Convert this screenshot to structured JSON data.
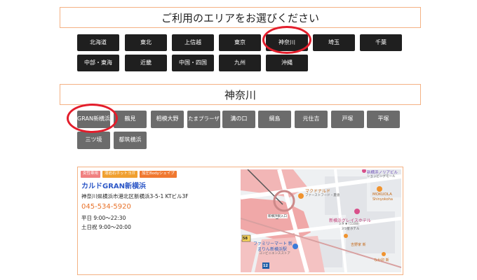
{
  "area_title": "ご利用のエリアをお選びください",
  "areas": [
    "北海道",
    "東北",
    "上信越",
    "東京",
    "神奈川",
    "埼玉",
    "千葉",
    "中部・東海",
    "近畿",
    "中国・四国",
    "九州",
    "沖縄"
  ],
  "sub_title": "神奈川",
  "sub_areas": [
    "GRAN新横浜",
    "鶴見",
    "相模大野",
    "たまプラーザ",
    "溝の口",
    "綱島",
    "元住吉",
    "戸塚",
    "平塚",
    "三ツ境",
    "都筑横浜"
  ],
  "shop": {
    "tags": [
      "女性専用",
      "溶岩石ホットヨガ",
      "加圧Bodyシェイプ"
    ],
    "name": "カルドGRAN新横浜",
    "address": "神奈川県横浜市港北区新横浜3-5-1 KTビル3F",
    "tel": "045-534-5920",
    "hours_weekday": "平日 9:00〜22:30",
    "hours_weekend": "土日祝 9:00〜20:00"
  },
  "map": {
    "labels": {
      "station_entrance": "新横浜駅入口",
      "mcdonalds": "マクドナルド",
      "mcdonalds_sub": "ファーストフード・夏値",
      "hotel": "新横浜グレイスホテル",
      "hotel_rating": "3.9 ★ (1108)",
      "hotel_class": "3つ星ホテル",
      "mokuola": "MOKUOLA",
      "mokuola_sub": "Shinyokoha",
      "familymart": "ファミリーマート 新",
      "familymart2": "まりん新横浜駅",
      "familymart_sub": "コンビニエンスストア",
      "yoshinoya": "吉野家 新",
      "nakau": "なか卯 新",
      "prism": "新横浜ノリアビル",
      "prism_sub": "ショッピングモール",
      "route": "58",
      "route2": "12"
    }
  },
  "colors": {
    "accent_border": "#f4b183",
    "dark_button": "#1f1f1f",
    "gray_button": "#6b6b6b",
    "highlight_circle": "#e31d2b",
    "shop_name": "#2d58c7",
    "tel": "#e8722a"
  }
}
